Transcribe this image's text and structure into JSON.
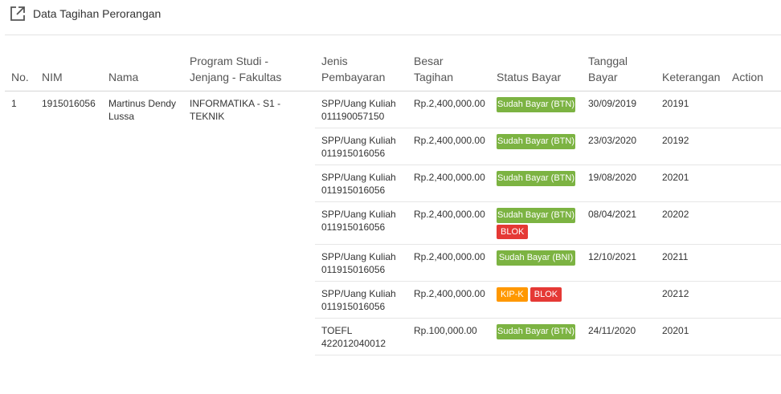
{
  "header": {
    "title": "Data Tagihan Perorangan"
  },
  "table": {
    "headers": {
      "no": "No.",
      "nim": "NIM",
      "nama": "Nama",
      "prodi": "Program Studi - Jenjang - Fakultas",
      "jenis": "Jenis Pembayaran",
      "besar": "Besar Tagihan",
      "status": "Status Bayar",
      "tanggal": "Tanggal Bayar",
      "keterangan": "Keterangan",
      "action": "Action"
    },
    "student": {
      "no": "1",
      "nim": "1915016056",
      "nama": "Martinus Dendy Lussa",
      "prodi": "INFORMATIKA - S1 - TEKNIK"
    },
    "rows": [
      {
        "jenis": "SPP/Uang Kuliah 011190057150",
        "besar": "Rp.2,400,000.00",
        "status": "Sudah Bayar (BTN)",
        "tanggal": "30/09/2019",
        "keterangan": "20191"
      },
      {
        "jenis": "SPP/Uang Kuliah 011915016056",
        "besar": "Rp.2,400,000.00",
        "status": "Sudah Bayar (BTN)",
        "tanggal": "23/03/2020",
        "keterangan": "20192"
      },
      {
        "jenis": "SPP/Uang Kuliah 011915016056",
        "besar": "Rp.2,400,000.00",
        "status": "Sudah Bayar (BTN)",
        "tanggal": "19/08/2020",
        "keterangan": "20201"
      },
      {
        "jenis": "SPP/Uang Kuliah 011915016056",
        "besar": "Rp.2,400,000.00",
        "status": "Sudah Bayar (BTN)",
        "extra_badge": "BLOK",
        "tanggal": "08/04/2021",
        "keterangan": "20202"
      },
      {
        "jenis": "SPP/Uang Kuliah 011915016056",
        "besar": "Rp.2,400,000.00",
        "status": "Sudah Bayar (BNI)",
        "tanggal": "12/10/2021",
        "keterangan": "20211"
      },
      {
        "jenis": "SPP/Uang Kuliah 011915016056",
        "besar": "Rp.2,400,000.00",
        "badge_kip": "KIP-K",
        "badge_blok": "BLOK",
        "tanggal": "",
        "keterangan": "20212"
      },
      {
        "jenis": "TOEFL 422012040012",
        "besar": "Rp.100,000.00",
        "status": "Sudah Bayar (BTN)",
        "tanggal": "24/11/2020",
        "keterangan": "20201"
      }
    ]
  },
  "colors": {
    "paid": "#7cb342",
    "blok": "#e53935",
    "kip": "#ff9800"
  },
  "icons": {
    "header": "external-link-icon"
  }
}
